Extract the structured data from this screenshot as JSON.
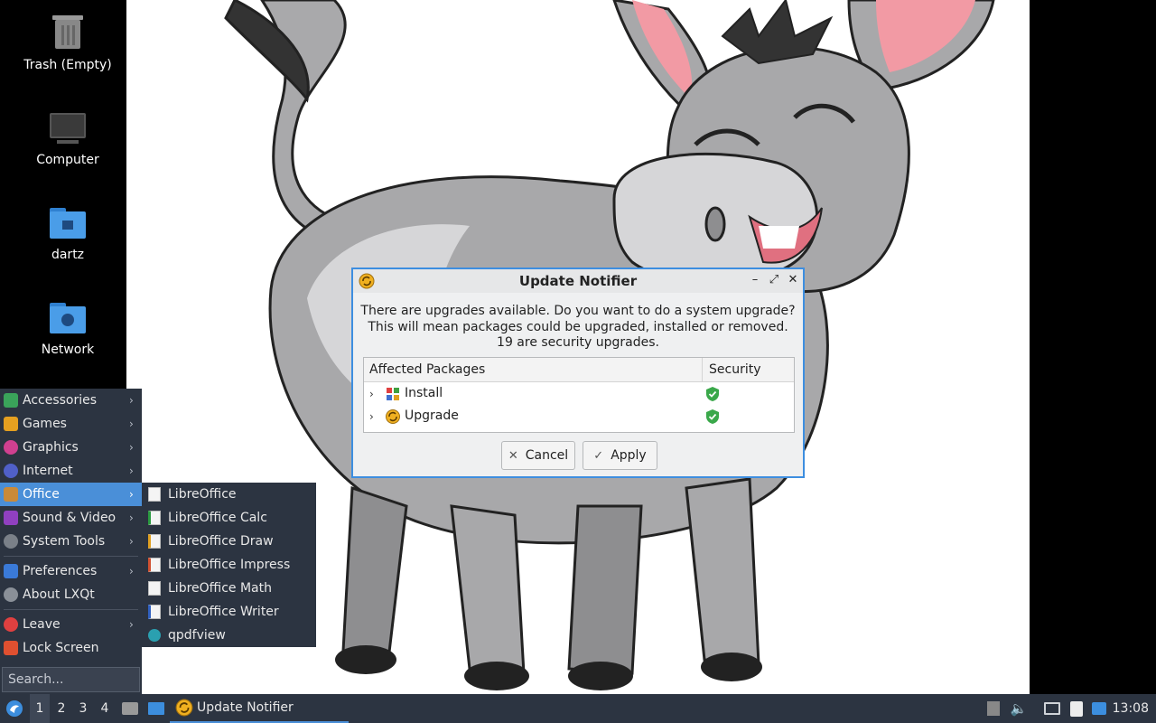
{
  "desktop": {
    "icons": [
      {
        "label": "Trash (Empty)"
      },
      {
        "label": "Computer"
      },
      {
        "label": "dartz"
      },
      {
        "label": "Network"
      }
    ]
  },
  "main_menu": {
    "items": [
      {
        "label": "Accessories",
        "icon": "accessories-icon",
        "color": "#3aa35a"
      },
      {
        "label": "Games",
        "icon": "games-icon",
        "color": "#e6a020"
      },
      {
        "label": "Graphics",
        "icon": "graphics-icon",
        "color": "#d04090"
      },
      {
        "label": "Internet",
        "icon": "internet-icon",
        "color": "#5060c8"
      },
      {
        "label": "Office",
        "icon": "office-icon",
        "color": "#c98a3a"
      },
      {
        "label": "Sound & Video",
        "icon": "sound-video-icon",
        "color": "#9040c0"
      },
      {
        "label": "System Tools",
        "icon": "system-tools-icon",
        "color": "#7a8088"
      },
      {
        "label": "Preferences",
        "icon": "preferences-icon",
        "color": "#3a7ad8"
      },
      {
        "label": "About LXQt",
        "icon": "info-icon",
        "color": "#8a9098"
      },
      {
        "label": "Leave",
        "icon": "power-icon",
        "color": "#e04040"
      },
      {
        "label": "Lock Screen",
        "icon": "lock-icon",
        "color": "#e05030"
      }
    ],
    "search_placeholder": "Search..."
  },
  "office_submenu": {
    "items": [
      {
        "label": "LibreOffice",
        "icon": "libreoffice-icon",
        "color": "#555555"
      },
      {
        "label": "LibreOffice Calc",
        "icon": "libreoffice-calc-icon",
        "color": "#2a9a40"
      },
      {
        "label": "LibreOffice Draw",
        "icon": "libreoffice-draw-icon",
        "color": "#e0a020"
      },
      {
        "label": "LibreOffice Impress",
        "icon": "libreoffice-impress-icon",
        "color": "#d05030"
      },
      {
        "label": "LibreOffice Math",
        "icon": "libreoffice-math-icon",
        "color": "#888888"
      },
      {
        "label": "LibreOffice Writer",
        "icon": "libreoffice-writer-icon",
        "color": "#3060c0"
      },
      {
        "label": "qpdfview",
        "icon": "eye-icon",
        "color": "#2aa0b0"
      }
    ]
  },
  "dialog": {
    "title": "Update Notifier",
    "message_lines": [
      "There are upgrades available. Do you want to do a system upgrade?",
      "This will mean packages could be upgraded, installed or removed.",
      "19 are security upgrades."
    ],
    "table": {
      "headers": [
        "Affected Packages",
        "Security"
      ],
      "rows": [
        {
          "label": "Install"
        },
        {
          "label": "Upgrade"
        }
      ]
    },
    "cancel_label": "Cancel",
    "apply_label": "Apply"
  },
  "taskbar": {
    "desktops": [
      "1",
      "2",
      "3",
      "4"
    ],
    "active_window": "Update Notifier",
    "clock": "13:08"
  }
}
